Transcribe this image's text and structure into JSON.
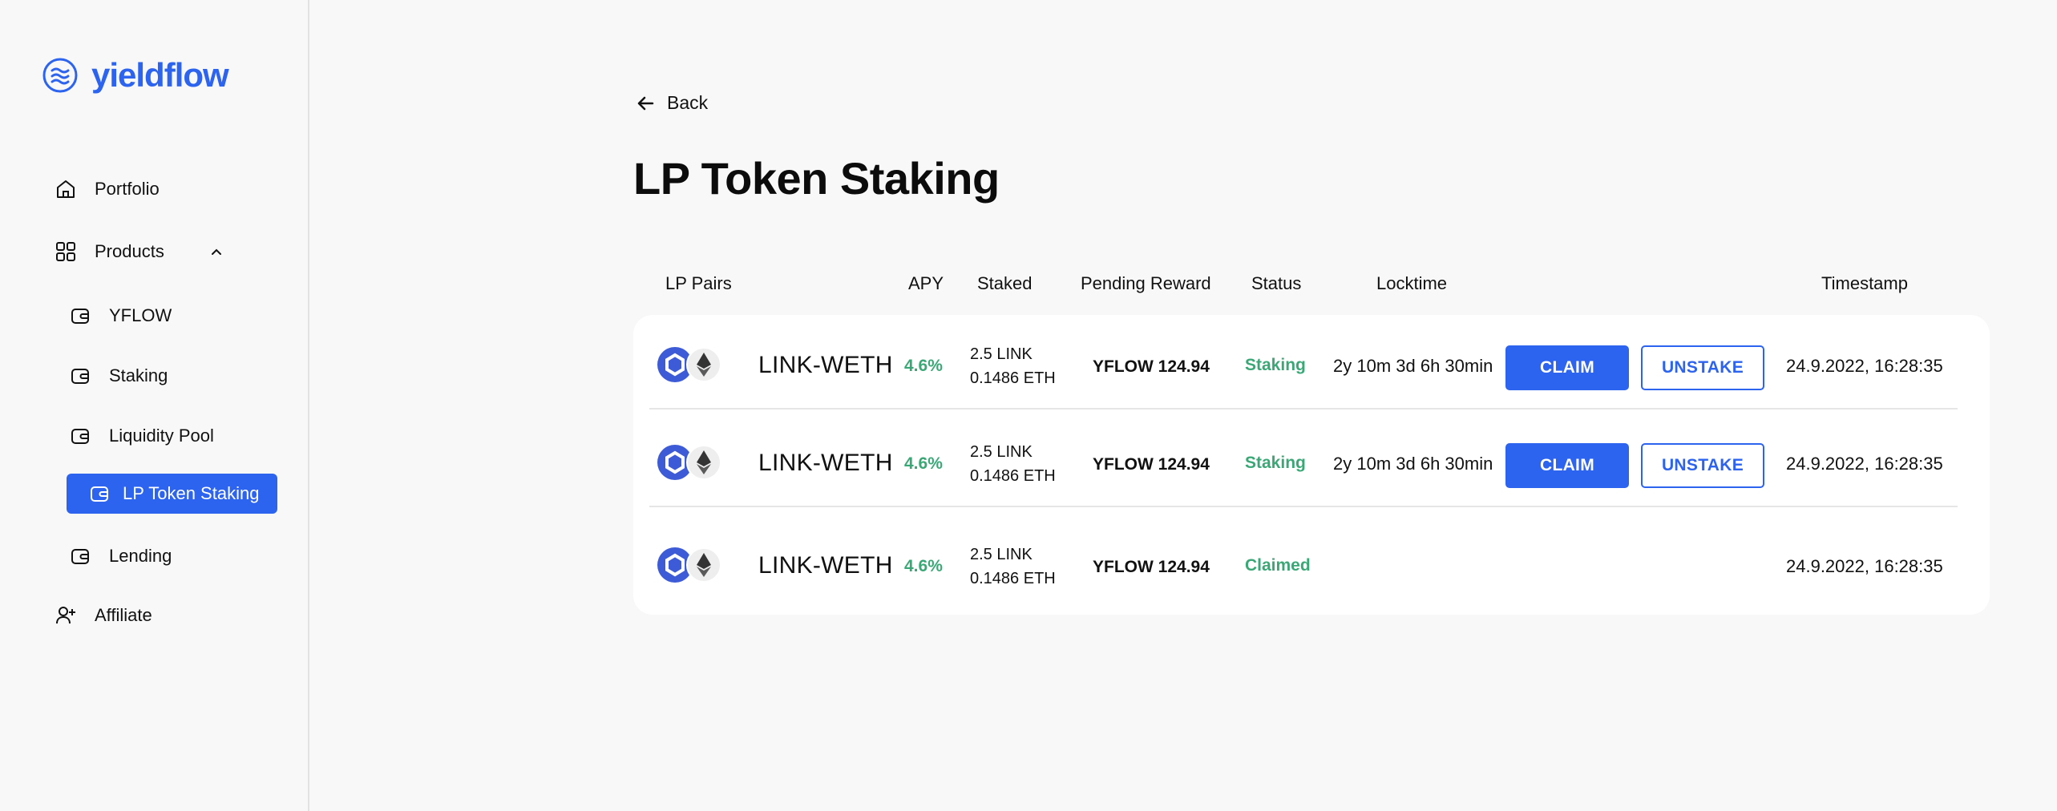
{
  "app": {
    "name": "yieldflow"
  },
  "sidebar": {
    "items": [
      {
        "label": "Portfolio",
        "icon": "home-icon"
      },
      {
        "label": "Products",
        "icon": "grid-icon",
        "expanded": true
      },
      {
        "label": "YFLOW",
        "icon": "wallet-icon"
      },
      {
        "label": "Staking",
        "icon": "wallet-icon"
      },
      {
        "label": "Liquidity Pool",
        "icon": "wallet-icon"
      },
      {
        "label": "LP Token Staking",
        "icon": "wallet-icon",
        "active": true
      },
      {
        "label": "Lending",
        "icon": "wallet-icon"
      },
      {
        "label": "Affiliate",
        "icon": "user-plus-icon"
      }
    ]
  },
  "back": {
    "label": "Back"
  },
  "page": {
    "title": "LP Token Staking"
  },
  "table": {
    "headers": [
      "LP Pairs",
      "APY",
      "Staked",
      "Pending Reward",
      "Status",
      "Locktime",
      "Timestamp"
    ],
    "rows": [
      {
        "pair": "LINK-WETH",
        "apy": "4.6%",
        "staked_1": "2.5 LINK",
        "staked_2": "0.1486 ETH",
        "reward": "YFLOW 124.94",
        "status": "Staking",
        "locktime": "2y 10m 3d 6h 30min",
        "claim": "CLAIM",
        "unstake": "UNSTAKE",
        "timestamp": "24.9.2022, 16:28:35"
      },
      {
        "pair": "LINK-WETH",
        "apy": "4.6%",
        "staked_1": "2.5 LINK",
        "staked_2": "0.1486 ETH",
        "reward": "YFLOW 124.94",
        "status": "Staking",
        "locktime": "2y 10m 3d 6h 30min",
        "claim": "CLAIM",
        "unstake": "UNSTAKE",
        "timestamp": "24.9.2022, 16:28:35"
      },
      {
        "pair": "LINK-WETH",
        "apy": "4.6%",
        "staked_1": "2.5 LINK",
        "staked_2": "0.1486 ETH",
        "reward": "YFLOW 124.94",
        "status": "Claimed",
        "locktime": "",
        "timestamp": "24.9.2022, 16:28:35"
      }
    ]
  },
  "colors": {
    "accent": "#2c63ef",
    "positive": "#3aa876",
    "background": "#f8f8f8",
    "card": "#ffffff"
  }
}
